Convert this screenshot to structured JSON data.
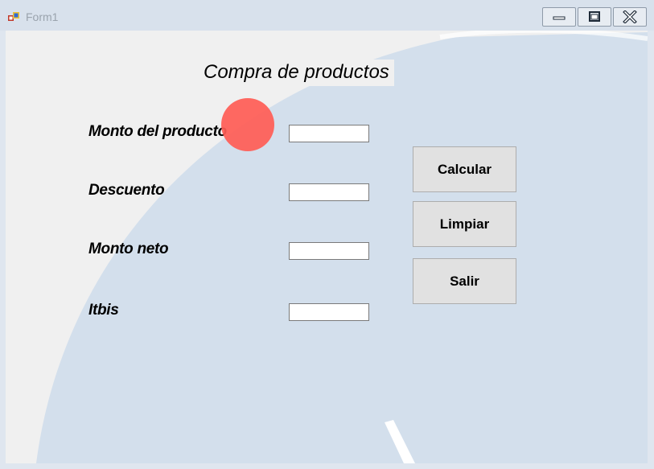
{
  "window": {
    "title": "Form1",
    "controls": {
      "minimize": "minimize",
      "maximize": "maximize",
      "close": "close"
    }
  },
  "form": {
    "heading": "Compra de productos",
    "fields": [
      {
        "label": "Monto del producto",
        "value": ""
      },
      {
        "label": "Descuento",
        "value": ""
      },
      {
        "label": "Monto neto",
        "value": ""
      },
      {
        "label": "Itbis",
        "value": ""
      }
    ],
    "buttons": {
      "calcular": "Calcular",
      "limpiar": "Limpiar",
      "salir": "Salir"
    }
  },
  "colors": {
    "form_background": "#f0f0f0",
    "background_arc": "#d3dfec",
    "cursor_highlight": "#ff5c55"
  },
  "icons": {
    "app": "windows-form-icon",
    "minimize": "minimize-icon",
    "maximize": "maximize-icon",
    "close": "close-icon"
  }
}
